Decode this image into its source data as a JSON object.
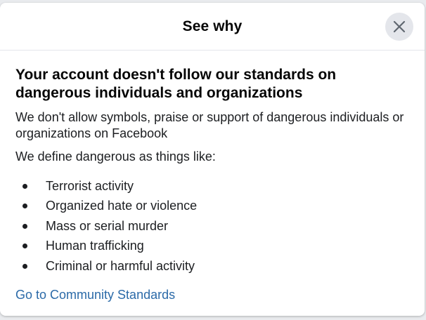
{
  "dialog": {
    "title": "See why",
    "close_icon": "close-icon"
  },
  "content": {
    "heading": "Your account doesn't follow our standards on dangerous individuals and organizations",
    "description": "We don't allow symbols, praise or support of dangerous individuals or organizations on Facebook",
    "define_text": "We define dangerous as things like:",
    "examples": [
      "Terrorist activity",
      "Organized hate or violence",
      "Mass or serial murder",
      "Human trafficking",
      "Criminal or harmful activity"
    ],
    "link_label": "Go to Community Standards"
  },
  "colors": {
    "link": "#2b6aa8",
    "close_button_bg": "#e4e6eb",
    "text": "#1c1e21"
  }
}
